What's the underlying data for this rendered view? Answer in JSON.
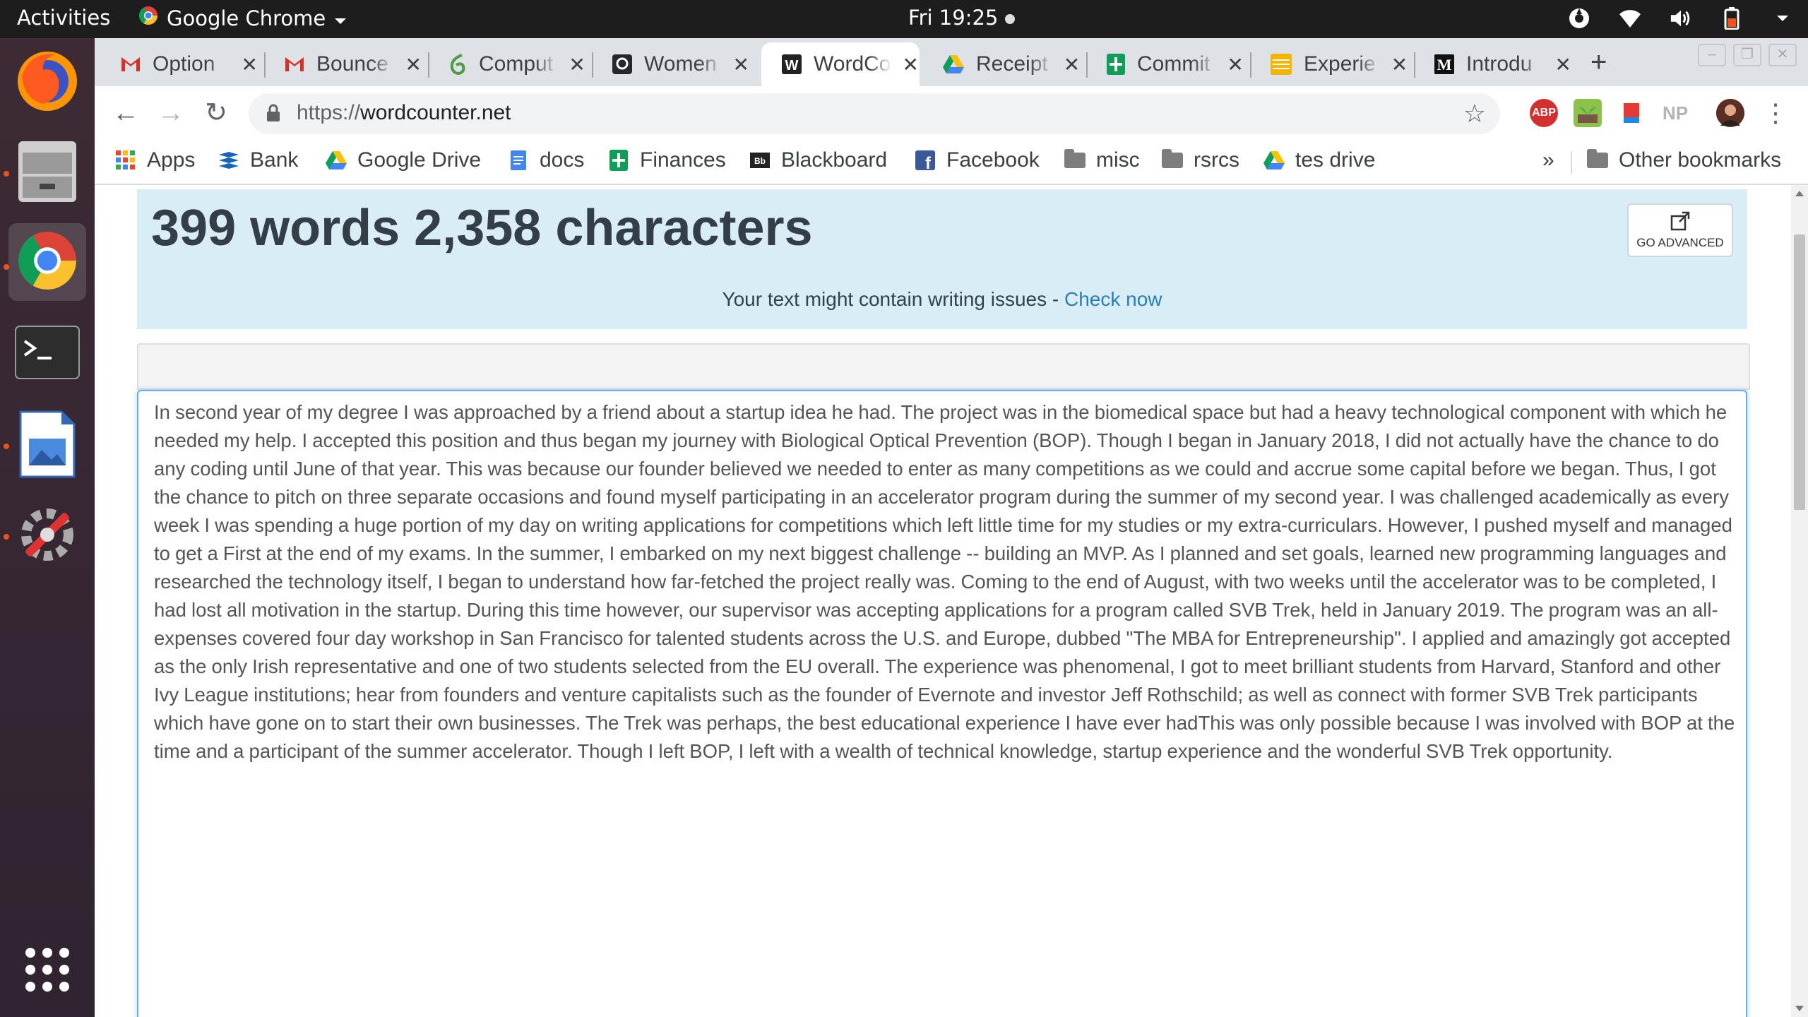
{
  "system_bar": {
    "activities": "Activities",
    "app_name": "Google Chrome",
    "clock": "Fri 19:25"
  },
  "dock": {
    "apps": [
      "firefox-icon",
      "file-manager-icon",
      "chrome-icon",
      "terminal-icon",
      "image-viewer-icon",
      "system-tools-icon"
    ],
    "show_apps_icon": "show-apps-icon"
  },
  "tabs": [
    {
      "title": "Option",
      "favicon": "gmail-icon",
      "active": false
    },
    {
      "title": "Bounce",
      "favicon": "gmail-icon",
      "active": false
    },
    {
      "title": "Comput",
      "favicon": "overleaf-icon",
      "active": false
    },
    {
      "title": "Women",
      "favicon": "github-icon",
      "active": false
    },
    {
      "title": "WordCo",
      "favicon": "wordcounter-icon",
      "active": true
    },
    {
      "title": "Receipt",
      "favicon": "drive-icon",
      "active": false
    },
    {
      "title": "Commit",
      "favicon": "sheets-icon",
      "active": false
    },
    {
      "title": "Experie",
      "favicon": "slides-icon",
      "active": false
    },
    {
      "title": "Introdu",
      "favicon": "medium-icon",
      "active": false
    }
  ],
  "toolbar": {
    "url_scheme": "https://",
    "url_host": "wordcounter.net",
    "extensions": [
      {
        "name": "adblock-plus-icon",
        "label": "ABP"
      },
      {
        "name": "extension-plant-icon",
        "label": ""
      },
      {
        "name": "extension-book-icon",
        "label": ""
      },
      {
        "name": "np-extension-icon",
        "label": "NP"
      }
    ]
  },
  "bookmarks": {
    "items": [
      "Apps",
      "Bank",
      "Google Drive",
      "docs",
      "Finances",
      "Blackboard",
      "Facebook",
      "misc",
      "rsrcs",
      "tes drive"
    ],
    "overflow": "»",
    "other": "Other bookmarks"
  },
  "page": {
    "word_count": "399 words 2,358 characters",
    "issues_text": "Your text might contain writing issues - ",
    "issues_link": "Check now",
    "advanced_button": "GO ADVANCED",
    "editor_text": "In second year of my degree I was approached by a friend about a startup idea he had. The project was in the biomedical space but had a heavy technological component with which he needed my help. I accepted this position and thus began my journey with Biological Optical Prevention (BOP). Though I began in January 2018, I did not actually have the chance to do any coding until June of that year. This was because our founder believed we needed to enter as many competitions as we could and accrue some capital before we began. Thus, I got the chance to pitch on three separate occasions and found myself participating in an accelerator program during the summer of my second year.  I was challenged academically as every week I was spending a huge portion of my day on writing applications for competitions which left little time for my studies or my extra-curriculars. However, I pushed myself and managed to get a First at the end of my exams. In the summer, I embarked on my next biggest challenge -- building an MVP. As I planned and set goals, learned new programming languages and researched the technology itself, I began to understand how far-fetched the project really was. Coming to the end of August, with two weeks until the accelerator was to be completed, I had lost all motivation in the startup. During this time however, our supervisor was accepting applications for a program called SVB Trek, held in January 2019. The program was an all-expenses covered four day workshop in San Francisco for talented students across the U.S. and Europe, dubbed \"The MBA for Entrepreneurship\". I applied and amazingly got accepted as the only Irish representative and one of two students selected from the EU overall. The experience was phenomenal, I got to meet brilliant students from Harvard, Stanford and other Ivy League institutions; hear from founders and venture capitalists such as the founder of Evernote and investor Jeff Rothschild; as well as connect with former SVB Trek participants which have gone on to start their own businesses. The Trek was perhaps, the best educational experience I have ever hadThis was only possible because I was involved with BOP at the time and a participant of the summer accelerator. Though I left BOP, I left with a wealth of technical knowledge, startup experience and the wonderful SVB Trek opportunity."
  },
  "colors": {
    "stat_box_bg": "#d9edf7",
    "link": "#2a7fb8",
    "editor_focus_border": "#66afe9"
  }
}
